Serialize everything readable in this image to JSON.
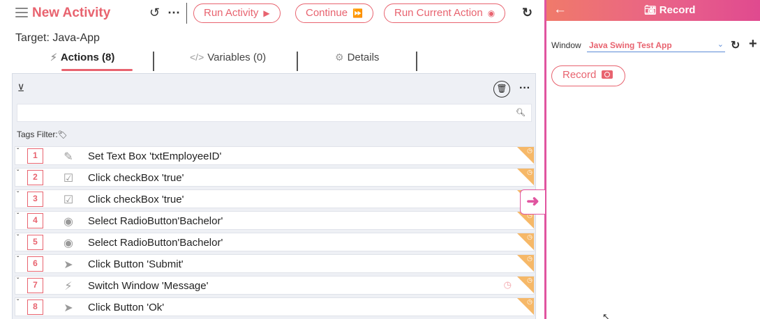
{
  "toolbar": {
    "title": "New Activity",
    "undo_icon": "undo-icon",
    "more_icon": "more-horizontal-icon",
    "run_activity_label": "Run Activity",
    "continue_label": "Continue",
    "run_current_label": "Run Current Action",
    "refresh_icon": "refresh-icon"
  },
  "target": "Target: Java-App",
  "tabs": [
    {
      "label": "Actions (8)",
      "icon": "lightning-icon",
      "active": true
    },
    {
      "label": "Variables (0)",
      "icon": "code-icon",
      "active": false
    },
    {
      "label": "Details",
      "icon": "gear-icon",
      "active": false
    }
  ],
  "panel": {
    "search_placeholder": "",
    "tags_filter_label": "Tags Filter:"
  },
  "actions": [
    {
      "num": "1",
      "icon": "pencil-icon",
      "text": "Set Text Box 'txtEmployeeID'"
    },
    {
      "num": "2",
      "icon": "checkbox-icon",
      "text": "Click checkBox 'true'"
    },
    {
      "num": "3",
      "icon": "checkbox-icon",
      "text": "Click checkBox 'true'"
    },
    {
      "num": "4",
      "icon": "radio-icon",
      "text": "Select RadioButton'Bachelor'"
    },
    {
      "num": "5",
      "icon": "radio-icon",
      "text": "Select RadioButton'Bachelor'"
    },
    {
      "num": "6",
      "icon": "pointer-icon",
      "text": "Click Button 'Submit'"
    },
    {
      "num": "7",
      "icon": "lightning-icon",
      "text": "Switch Window 'Message'"
    },
    {
      "num": "8",
      "icon": "pointer-icon",
      "text": "Click Button 'Ok'"
    }
  ],
  "recorder": {
    "title": "Record",
    "window_label": "Window",
    "window_value": "Java Swing Test App",
    "record_label": "Record"
  },
  "colors": {
    "accent": "#e8636f",
    "divider": "#e0549f",
    "corner_tag": "#f6b868"
  }
}
